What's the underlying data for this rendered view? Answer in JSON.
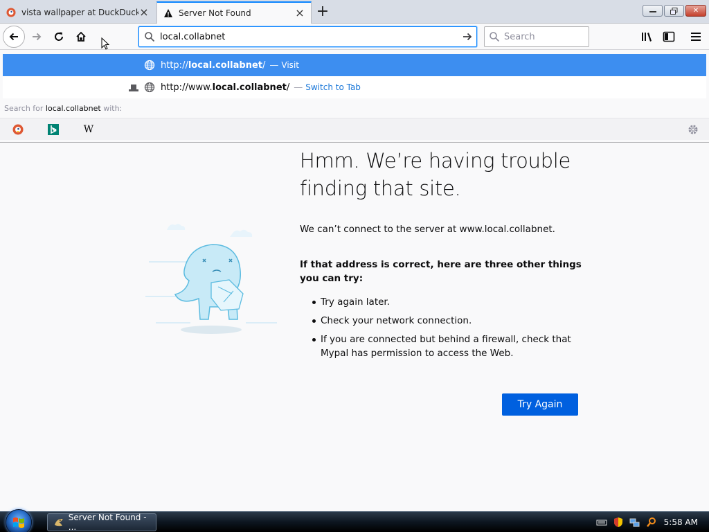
{
  "tabs": [
    {
      "title": "vista wallpaper at DuckDuckGo",
      "active": false,
      "favicon": "duckduckgo-icon"
    },
    {
      "title": "Server Not Found",
      "active": true,
      "favicon": "warning-icon"
    }
  ],
  "navbar": {
    "url": "local.collabnet",
    "search_placeholder": "Search"
  },
  "autocomplete": {
    "rows": [
      {
        "prefix": "http://",
        "bold": "local.collabnet",
        "suffix": "/",
        "separator": "—",
        "action": "Visit"
      },
      {
        "prefix": "http://www.",
        "bold": "local.collabnet",
        "suffix": "/",
        "separator": "—",
        "action": "Switch to Tab"
      }
    ],
    "search_with": {
      "pre": "Search for",
      "term": "local.collabnet",
      "post": "with:"
    },
    "engines": [
      "duckduckgo-icon",
      "bing-icon",
      "wikipedia-icon"
    ]
  },
  "error": {
    "title": "Hmm. We’re having trouble finding that site.",
    "description": "We can’t connect to the server at www.local.collabnet.",
    "subtitle": "If that address is correct, here are three other things you can try:",
    "items": [
      "Try again later.",
      "Check your network connection.",
      "If you are connected but behind a firewall, check that Mypal has permission to access the Web."
    ],
    "button": "Try Again"
  },
  "taskbar": {
    "item_label": "Server Not Found - ...",
    "clock": "5:58 AM"
  },
  "colors": {
    "accent": "#0a84ff",
    "selected_row": "#3d8ef0",
    "button": "#0060df"
  }
}
